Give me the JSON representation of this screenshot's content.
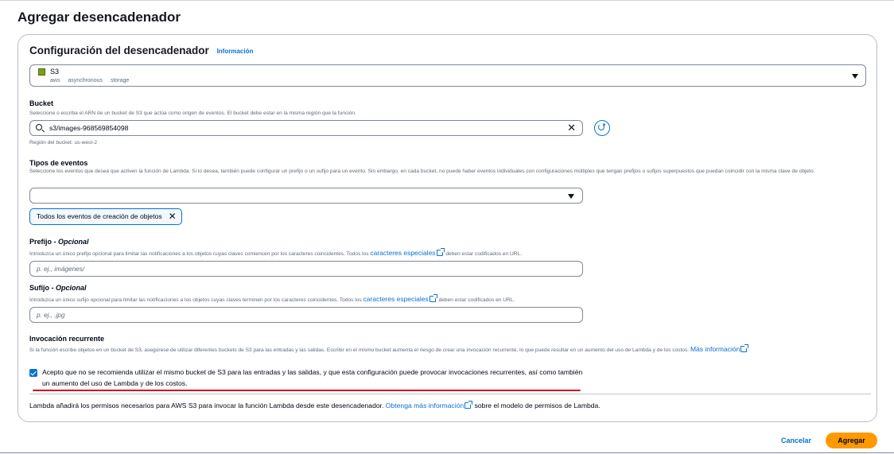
{
  "page": {
    "title": "Agregar desencadenador"
  },
  "card": {
    "title": "Configuración del desencadenador",
    "info_link": "Información"
  },
  "source": {
    "name": "S3",
    "tags": [
      "aws",
      "asynchronous",
      "storage"
    ],
    "logo_color": "#7aa116"
  },
  "bucket": {
    "label": "Bucket",
    "description": "Seleccione o escriba el ARN de un bucket de S3 que actúa como origen de eventos. El bucket debe estar en la misma región que la función.",
    "value": "s3/images-968569854098",
    "region_note": "Región del bucket: us-west-2"
  },
  "event_types": {
    "label": "Tipos de eventos",
    "description": "Seleccione los eventos que desea que activen la función de Lambda. Si lo desea, también puede configurar un prefijo o un sufijo para un evento. Sin embargo, en cada bucket, no puede haber eventos individuales con configuraciones múltiples que tengan prefijos o sufijos superpuestos que puedan coincidir con la misma clave de objeto.",
    "selected_token": "Todos los eventos de creación de objetos"
  },
  "prefix": {
    "label": "Prefijo - ",
    "optional": "Opcional",
    "desc_before": "Introduzca un único prefijo opcional para limitar las notificaciones a los objetos cuyas claves comiencen por los caracteres coincidentes. Todos los ",
    "desc_link": "caracteres especiales",
    "desc_after": " deben estar codificados en URL.",
    "placeholder": "p. ej., imágenes/"
  },
  "suffix": {
    "label": "Sufijo - ",
    "optional": "Opcional",
    "desc_before": "Introduzca un único sufijo opcional para limitar las notificaciones a los objetos cuyas claves terminen por los caracteres coincidentes. Todos los ",
    "desc_link": "caracteres especiales",
    "desc_after": " deben estar codificados en URL.",
    "placeholder": "p. ej., .jpg"
  },
  "recursive": {
    "label": "Invocación recurrente",
    "description": "Si la función escribe objetos en un bucket de S3, asegúrese de utilizar diferentes buckets de S3 para las entradas y las salidas. Escribir en el mismo bucket aumenta el riesgo de crear una invocación recurrente, lo que puede resultar en un aumento del uso de Lambda y de los costos. ",
    "more_link": "Más información",
    "checked": true,
    "checkbox_text": "Acepto que no se recomienda utilizar el mismo bucket de S3 para las entradas y las salidas, y que esta configuración puede provocar invocaciones recurrentes, así como también un aumento del uso de Lambda y de los costos."
  },
  "footer": {
    "before": "Lambda añadirá los permisos necesarios para AWS S3 para invocar la función Lambda desde este desencadenador. ",
    "link": "Obtenga más información",
    "after": " sobre el modelo de permisos de Lambda."
  },
  "actions": {
    "cancel": "Cancelar",
    "add": "Agregar"
  },
  "colors": {
    "accent": "#0972d3",
    "primary_button": "#ff9900",
    "annotation": "#d40e1e"
  }
}
